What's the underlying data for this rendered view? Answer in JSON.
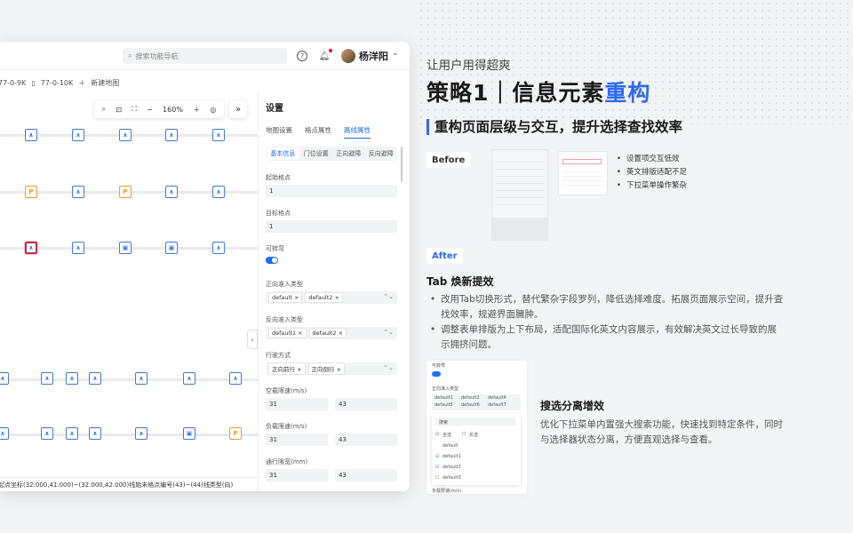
{
  "app": {
    "search_placeholder": "搜索功能导航",
    "user_name": "杨洋阳",
    "tabs": [
      "77-0-9K",
      "77-0-10K",
      "新建地图"
    ],
    "toolbar": {
      "zoom": "160%"
    },
    "status_bar": "起点坐标(32.000,41.000)~(32.000,42.000)线始末格点编号(43)~(44)线类型(向)"
  },
  "panel": {
    "title": "设置",
    "tabs": [
      "地图设置",
      "格点属性",
      "路线属性"
    ],
    "active_tab": "路线属性",
    "subtabs": [
      "基本信息",
      "门位设置",
      "正向避障",
      "反向避障"
    ],
    "active_subtab": "基本信息",
    "fields": {
      "start_label": "起始格点",
      "start_value": "1",
      "target_label": "目标格点",
      "target_value": "1",
      "turnable_label": "可转弯",
      "fwd_entry_label": "正向准入类型",
      "fwd_entry_tags": [
        "default",
        "default2"
      ],
      "rev_entry_label": "反向准入类型",
      "rev_entry_tags": [
        "default1",
        "default2"
      ],
      "drive_label": "行驶方式",
      "drive_tags": [
        "正向前行",
        "正向倒行"
      ],
      "empty_speed_label": "空载限速(m/s)",
      "empty_speed": [
        "31",
        "43"
      ],
      "load_speed_label": "负载限速(m/s)",
      "load_speed": [
        "31",
        "43"
      ],
      "width_label": "通行限宽(mm)",
      "width": [
        "31",
        "43"
      ]
    }
  },
  "slide": {
    "kicker": "让用户用得超爽",
    "headline_prefix": "策略1｜信息元素",
    "headline_accent": "重构",
    "subhead": "重构页面层级与交互，提升选择查找效率",
    "before_label": "Before",
    "after_label": "After",
    "before_points": [
      "设置项交互低效",
      "英文排版适配不足",
      "下拉菜单操作繁杂"
    ],
    "tab_title": "Tab 焕新提效",
    "tab_points": [
      "改用Tab切换形式，替代繁杂字段罗列，降低选择难度。拓展页面展示空间，提升查找效率，规避界面臃肿。",
      "调整表单排版为上下布局，适配国际化英文内容展示，有效解决英文过长导致的展示拥挤问题。"
    ],
    "search_title": "搜选分离增效",
    "search_desc": "优化下拉菜单内置强大搜索功能，快速找到特定条件，同时与选择器状态分离，方便直观选择与查看。",
    "mini": {
      "turnable": "可转弯",
      "fwd_entry": "正向准入类型",
      "tags": [
        "default1",
        "default2",
        "default4",
        "default5",
        "default6",
        "default7"
      ],
      "search": "搜索",
      "select_all": "全选",
      "invert": "反选",
      "options": [
        "default",
        "default1",
        "default2",
        "default3"
      ],
      "load_speed": "负载限速(m/s)"
    }
  },
  "colors": {
    "accent": "#2f6af0",
    "node_blue": "#3b7ddd",
    "node_orange": "#f39a2b",
    "selected": "#c0304a"
  }
}
